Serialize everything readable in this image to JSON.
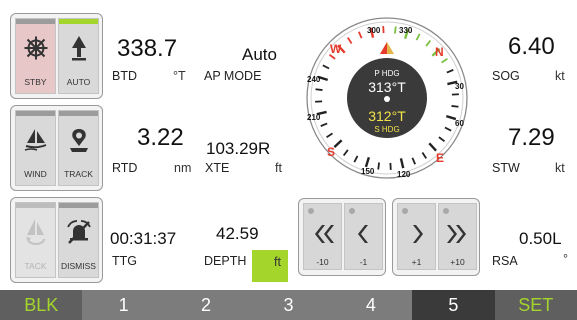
{
  "panels": {
    "mode_tiles": {
      "stby": "STBY",
      "auto": "AUTO"
    },
    "nav_tiles": {
      "wind": "WIND",
      "track": "TRACK"
    },
    "alarm_tiles": {
      "tack": "TACK",
      "dismiss": "DISMISS"
    }
  },
  "readouts": {
    "btd": {
      "value": "338.7",
      "label": "BTD",
      "unit": "°T"
    },
    "ap_mode": {
      "value": "Auto",
      "label": "AP MODE"
    },
    "rtd": {
      "value": "3.22",
      "label": "RTD",
      "unit": "nm"
    },
    "xte": {
      "value": "103.29R",
      "label": "XTE",
      "unit": "ft"
    },
    "ttg": {
      "value": "00:31:37",
      "label": "TTG"
    },
    "depth": {
      "value": "42.59",
      "label": "DEPTH",
      "unit": "ft"
    },
    "sog": {
      "value": "6.40",
      "label": "SOG",
      "unit": "kt"
    },
    "stw": {
      "value": "7.29",
      "label": "STW",
      "unit": "kt"
    },
    "rsa": {
      "value": "0.50L",
      "label": "RSA",
      "unit": "°"
    }
  },
  "compass": {
    "p_hdg_label": "P HDG",
    "p_hdg_value": "313°T",
    "s_hdg_value": "312°T",
    "s_hdg_label": "S HDG",
    "ticks": {
      "n": "N",
      "e": "E",
      "s": "S",
      "w": "W",
      "d300": "300",
      "d330": "330",
      "d30": "30",
      "d60": "60",
      "d120": "120",
      "d150": "150",
      "d210": "210",
      "d240": "240"
    }
  },
  "adjust_buttons": {
    "m10": "-10",
    "m1": "-1",
    "p1": "+1",
    "p10": "+10"
  },
  "footer": [
    "BLK",
    "1",
    "2",
    "3",
    "4",
    "5",
    "SET"
  ],
  "colors": {
    "accent": "#a4d52b",
    "red": "#e53b2c",
    "yellow": "#f2e34a",
    "stby_bg": "#e7c7c7"
  }
}
